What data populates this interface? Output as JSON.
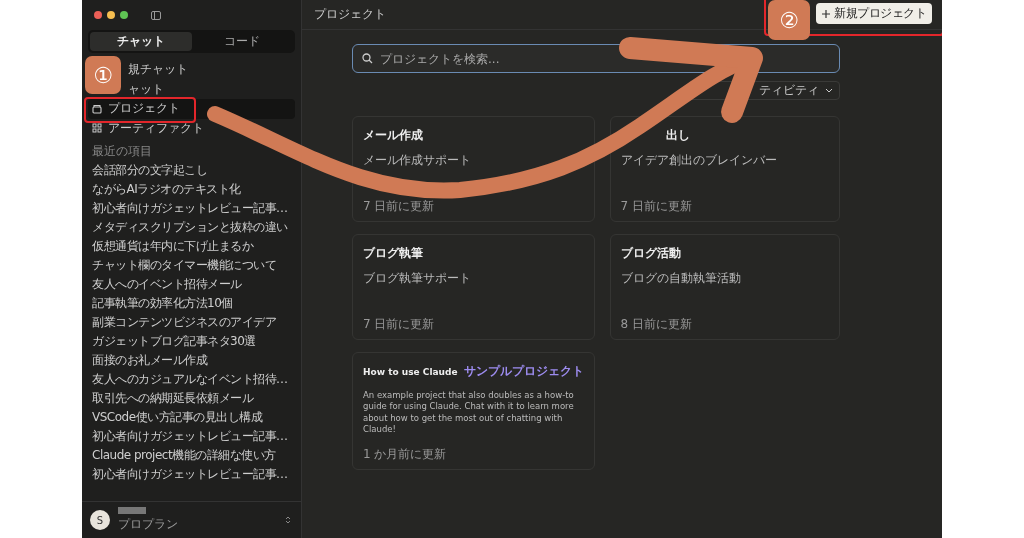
{
  "sidebar": {
    "tabs": [
      {
        "label": "チャット",
        "selected": true
      },
      {
        "label": "コード",
        "selected": false
      }
    ],
    "nav": [
      {
        "label": "規チャット",
        "kind": "chat",
        "selected": false
      },
      {
        "label": "ャット",
        "kind": "chat",
        "selected": false
      },
      {
        "label": "プロジェクト",
        "kind": "projects",
        "selected": true
      },
      {
        "label": "アーティファクト",
        "kind": "artifacts",
        "selected": false
      }
    ],
    "recent_heading": "最近の項目",
    "recent": [
      "会話部分の文字起こし",
      "ながらAIラジオのテキスト化",
      "初心者向けガジェットレビュー記事…",
      "メタディスクリプションと抜粋の違い",
      "仮想通貨は年内に下げ止まるか",
      "チャット欄のタイマー機能について",
      "友人へのイベント招待メール",
      "記事執筆の効率化方法10個",
      "副業コンテンツビジネスのアイデア",
      "ガジェットブログ記事ネタ30選",
      "面接のお礼メール作成",
      "友人へのカジュアルなイベント招待…",
      "取引先への納期延長依頼メール",
      "VSCode使い方記事の見出し構成",
      "初心者向けガジェットレビュー記事…",
      "Claude project機能の詳細な使い方",
      "初心者向けガジェットレビュー記事…"
    ],
    "user": {
      "avatar": "S",
      "plan": "プロプラン"
    }
  },
  "main": {
    "title": "プロジェクト",
    "new_project_button": "新規プロジェクト",
    "search": {
      "placeholder": "プロジェクトを検索..."
    },
    "sort": "ティビティ",
    "projects": [
      {
        "title": "メール作成",
        "description": "メール作成サポート",
        "updated": "7 日前に更新"
      },
      {
        "title": "出し",
        "description": "アイデア創出のブレインバー",
        "updated": "7 日前に更新"
      },
      {
        "title": "ブログ執筆",
        "description": "ブログ執筆サポート",
        "updated": "7 日前に更新"
      },
      {
        "title": "ブログ活動",
        "description": "ブログの自動執筆活動",
        "updated": "8 日前に更新"
      },
      {
        "title": "How to use Claude",
        "badge": "サンプルプロジェクト",
        "description": "An example project that also doubles as a how-to guide for using Claude. Chat with it to learn more about how to get the most out of chatting with Claude!",
        "updated": "1 か月前に更新"
      }
    ]
  },
  "annotations": {
    "markers": [
      "①",
      "②"
    ]
  }
}
